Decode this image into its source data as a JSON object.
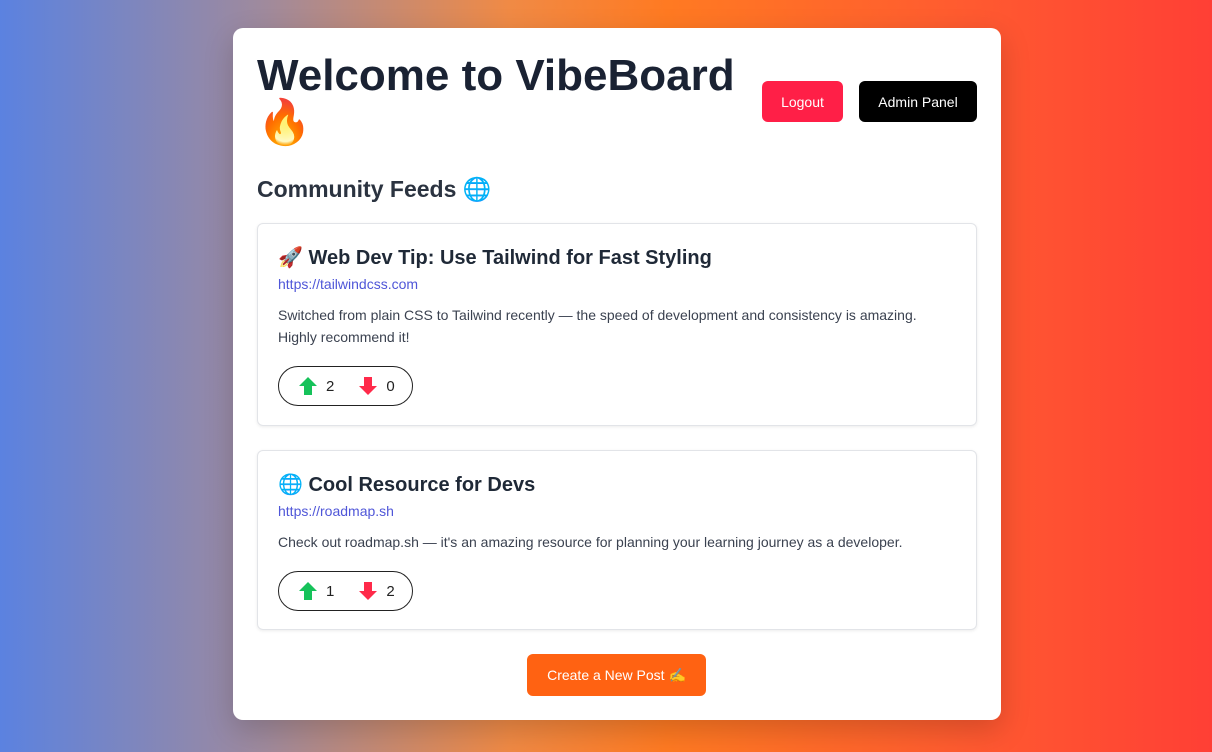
{
  "header": {
    "title": "Welcome to VibeBoard 🔥",
    "logout_label": "Logout",
    "admin_label": "Admin Panel"
  },
  "feeds_title": "Community Feeds 🌐",
  "posts": [
    {
      "title": "🚀 Web Dev Tip: Use Tailwind for Fast Styling",
      "link": "https://tailwindcss.com",
      "body": "Switched from plain CSS to Tailwind recently — the speed of development and consistency is amazing. Highly recommend it!",
      "upvotes": "2",
      "downvotes": "0"
    },
    {
      "title": "🌐 Cool Resource for Devs",
      "link": "https://roadmap.sh",
      "body": "Check out roadmap.sh — it's an amazing resource for planning your learning journey as a developer.",
      "upvotes": "1",
      "downvotes": "2"
    }
  ],
  "create_label": "Create a New Post ✍️",
  "colors": {
    "logout": "#ff1f47",
    "admin": "#000000",
    "create": "#ff6212",
    "upvote": "#16c25a",
    "downvote": "#ff2a4a",
    "link": "#4f56d8"
  },
  "icons": {
    "upvote": "up-arrow-icon",
    "downvote": "down-arrow-icon"
  }
}
